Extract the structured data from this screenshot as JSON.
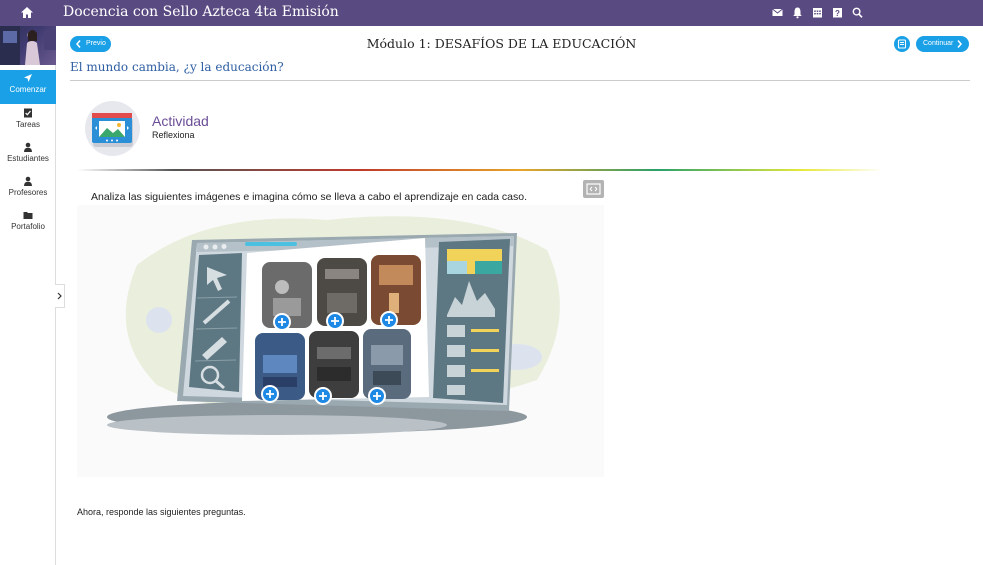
{
  "header": {
    "app_title": "Docencia con Sello Azteca 4ta Emisión",
    "icons": [
      "mail-icon",
      "bell-icon",
      "calendar-icon",
      "help-icon",
      "search-icon"
    ]
  },
  "sidebar": {
    "items": [
      {
        "label": "Comenzar",
        "icon": "navigation-arrow-icon",
        "active": true
      },
      {
        "label": "Tareas",
        "icon": "task-icon",
        "active": false
      },
      {
        "label": "Estudiantes",
        "icon": "person-icon",
        "active": false
      },
      {
        "label": "Profesores",
        "icon": "person-icon",
        "active": false
      },
      {
        "label": "Portafolio",
        "icon": "folder-icon",
        "active": false
      }
    ]
  },
  "nav": {
    "prev_label": "Previo",
    "next_label": "Continuar",
    "module_title": "Módulo 1: DESAFÍOS DE LA EDUCACIÓN",
    "section_title": "El mundo cambia, ¿y la educación?"
  },
  "activity": {
    "label": "Actividad",
    "subtitle": "Reflexiona",
    "instruction": "Analiza las siguientes imágenes e imagina cómo se lleva a cabo el aprendizaje en cada caso."
  },
  "footer_text": "Ahora, responde las siguientes preguntas.",
  "colors": {
    "topbar": "#5a4a82",
    "accent": "#1aa0e6",
    "section_title": "#2e5ea3",
    "activity_label": "#6a4d96"
  }
}
